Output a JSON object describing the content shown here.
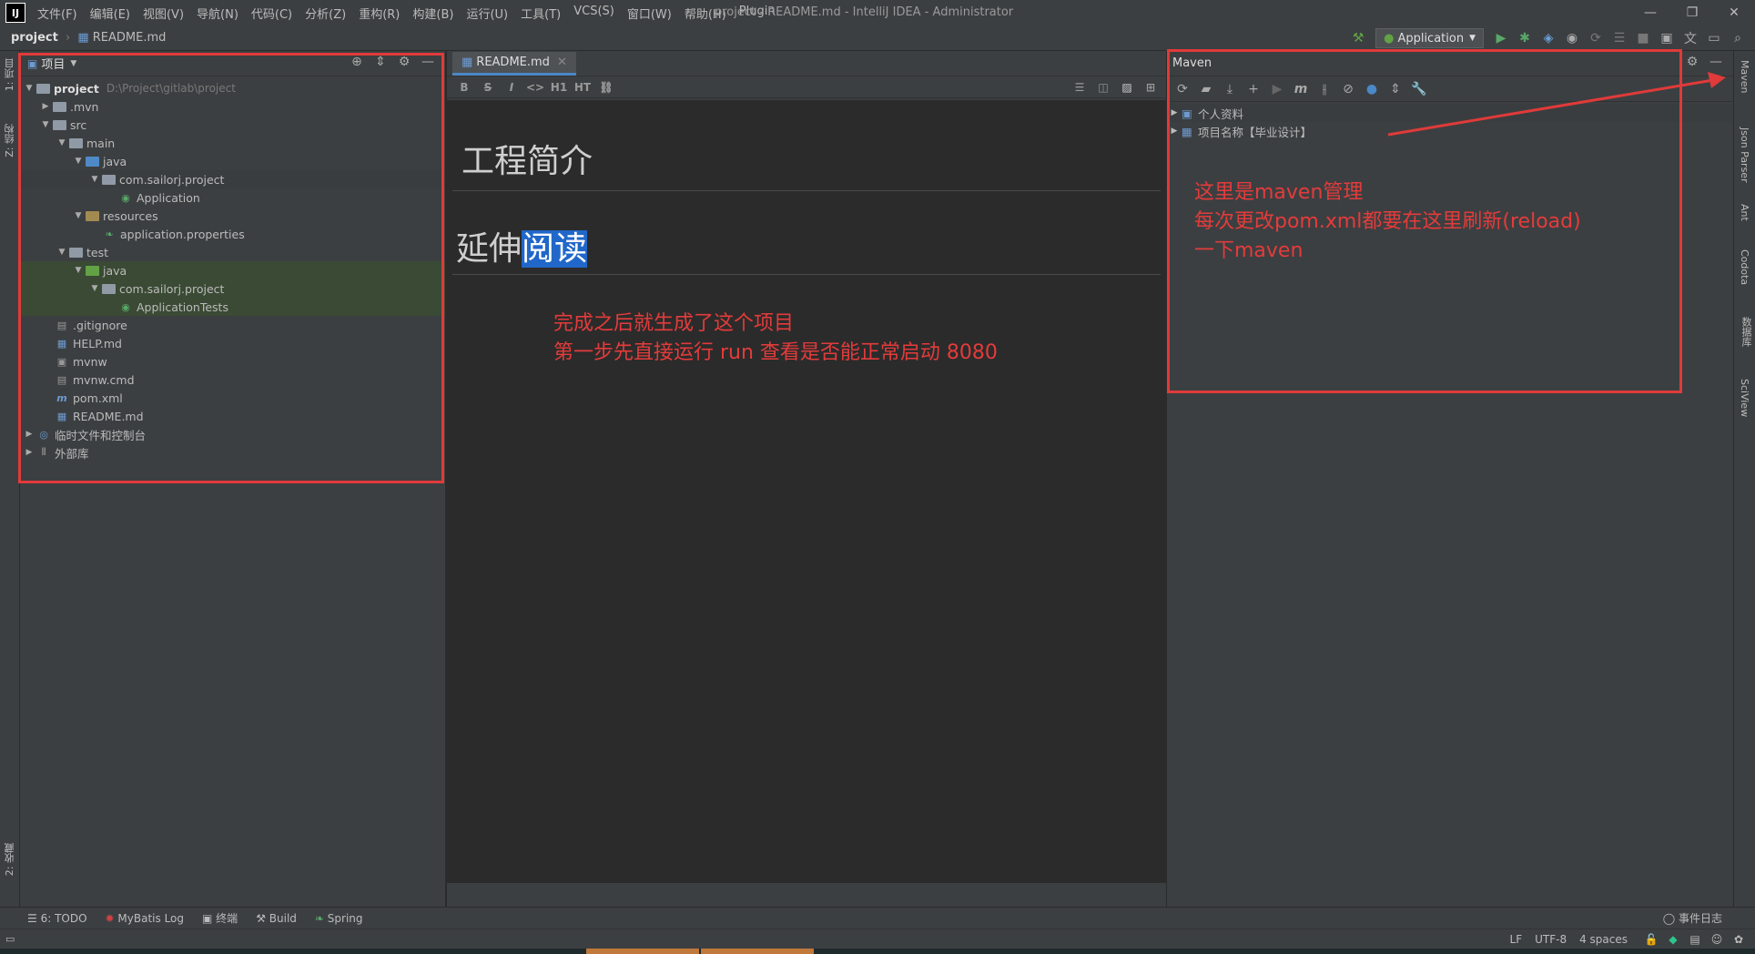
{
  "titlebar": {
    "menu": [
      "文件(F)",
      "编辑(E)",
      "视图(V)",
      "导航(N)",
      "代码(C)",
      "分析(Z)",
      "重构(R)",
      "构建(B)",
      "运行(U)",
      "工具(T)",
      "VCS(S)",
      "窗口(W)",
      "帮助(H)",
      "Plugin"
    ],
    "title": "project - README.md - IntelliJ IDEA - Administrator",
    "logo": "IJ"
  },
  "navbar": {
    "project": "project",
    "file": "README.md",
    "run_config": "Application"
  },
  "leftstrip": {
    "tab1": "1: 项目",
    "tab2": "Z: 结构",
    "tab3": "2: 收藏"
  },
  "rightstrip": {
    "tabs": [
      "Maven",
      "Json Parser",
      "Ant",
      "Codota",
      "数据库",
      "SciView"
    ]
  },
  "project_panel": {
    "title": "项目",
    "tree": [
      {
        "label": "project",
        "path": "D:\\Project\\gitlab\\project"
      },
      {
        "label": ".mvn"
      },
      {
        "label": "src"
      },
      {
        "label": "main"
      },
      {
        "label": "java"
      },
      {
        "label": "com.sailorj.project"
      },
      {
        "label": "Application"
      },
      {
        "label": "resources"
      },
      {
        "label": "application.properties"
      },
      {
        "label": "test"
      },
      {
        "label": "java"
      },
      {
        "label": "com.sailorj.project"
      },
      {
        "label": "ApplicationTests"
      },
      {
        "label": ".gitignore"
      },
      {
        "label": "HELP.md"
      },
      {
        "label": "mvnw"
      },
      {
        "label": "mvnw.cmd"
      },
      {
        "label": "pom.xml"
      },
      {
        "label": "README.md"
      },
      {
        "label": "临时文件和控制台"
      },
      {
        "label": "外部库"
      }
    ]
  },
  "editor": {
    "tab": "README.md",
    "md_tools": [
      "B",
      "S",
      "I",
      "<>",
      "H1",
      "HT",
      "⛓"
    ],
    "heading1": "工程简介",
    "heading2_plain": "延伸",
    "heading2_highlight": "阅读"
  },
  "maven": {
    "title": "Maven",
    "tree": [
      "个人资料",
      "项目名称【毕业设计】"
    ]
  },
  "annotations": {
    "editor_note": [
      "完成之后就生成了这个项目",
      "第一步先直接运行 run 查看是否能正常启动 8080"
    ],
    "maven_note": [
      "这里是maven管理",
      "每次更改pom.xml都要在这里刷新(reload)",
      "一下maven"
    ]
  },
  "bottombar": {
    "tools": [
      "6: TODO",
      "MyBatis Log",
      "终端",
      "Build",
      "Spring"
    ],
    "event_log": "事件日志"
  },
  "statusbar": {
    "line_sep": "LF",
    "encoding": "UTF-8",
    "indent": "4 spaces"
  },
  "colors": {
    "accent_red": "#e03a3a",
    "selection_blue": "#2167c9",
    "tab_underline": "#4a88c7"
  }
}
